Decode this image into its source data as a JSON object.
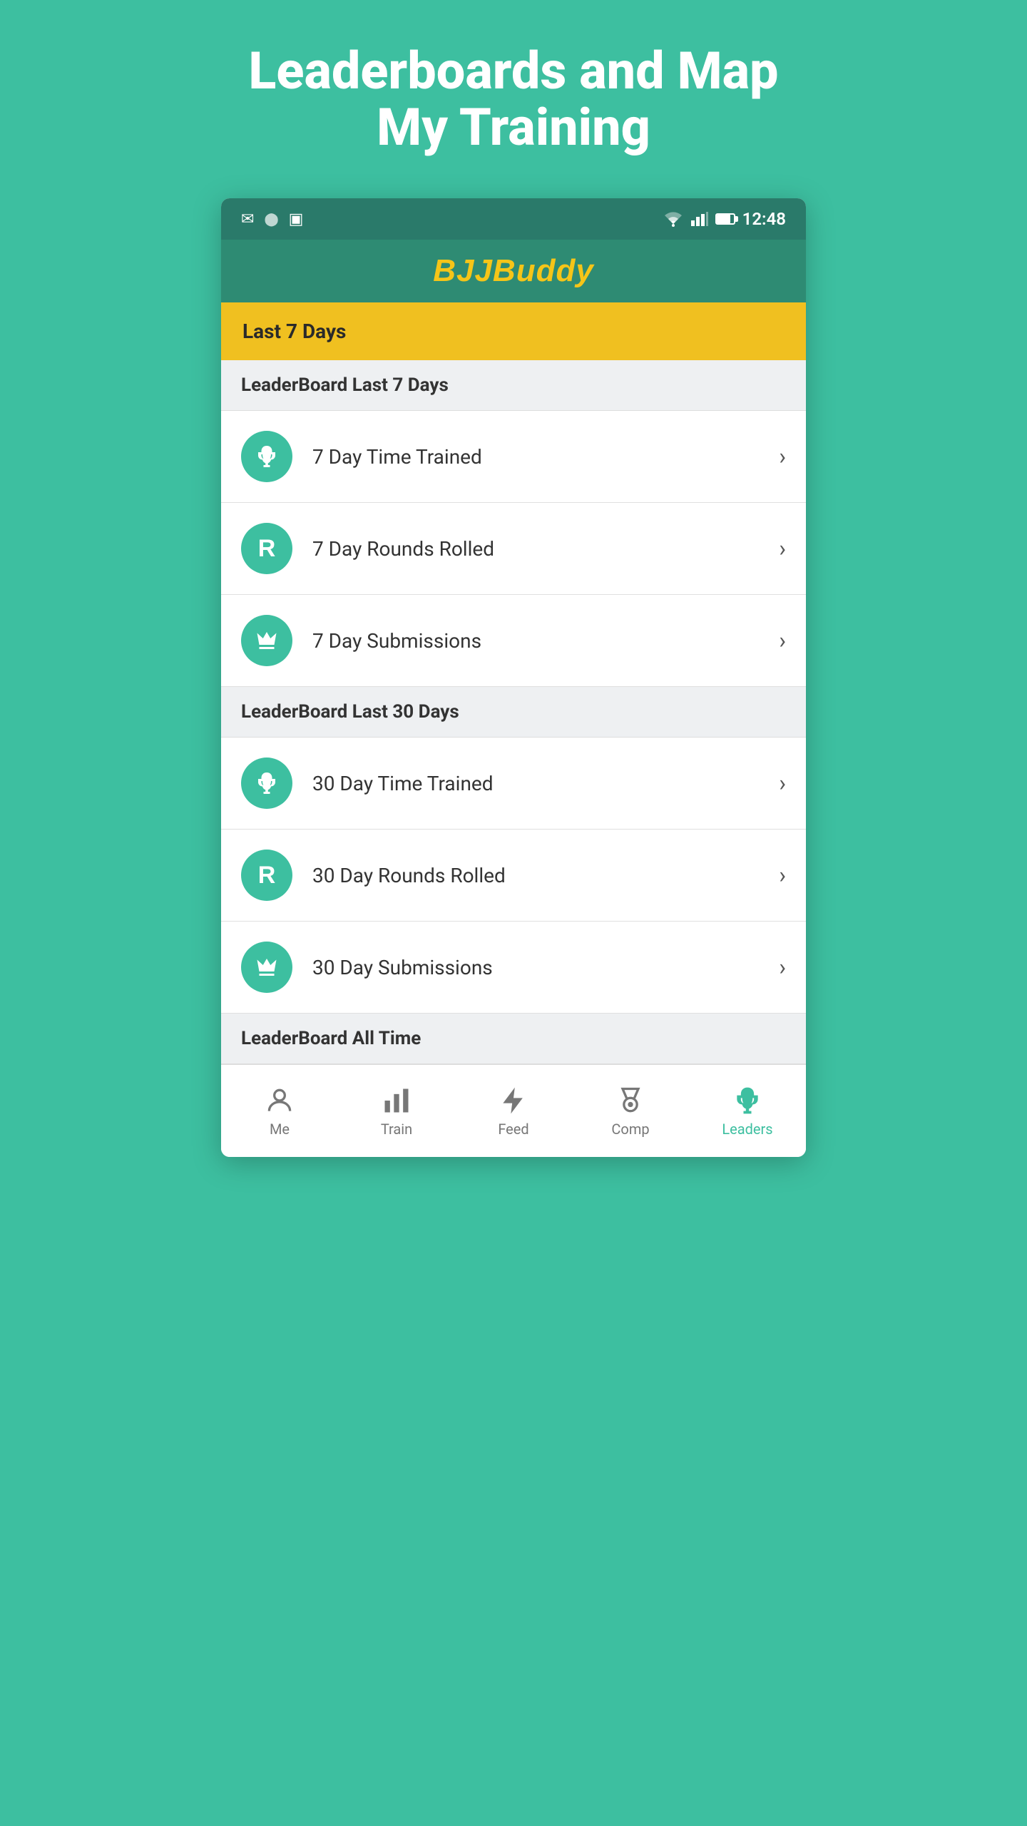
{
  "page": {
    "title_line1": "Leaderboards and Map",
    "title_line2": "My Training",
    "bg_color": "#3dbfa0"
  },
  "status_bar": {
    "time": "12:48",
    "icons": [
      "mail",
      "circle",
      "doc"
    ]
  },
  "header": {
    "logo": "BJJBuddy"
  },
  "filter_bar": {
    "label": "Last 7 Days"
  },
  "sections": [
    {
      "id": "leaderboard_7",
      "header": "LeaderBoard Last 7 Days",
      "items": [
        {
          "id": "7_time",
          "icon": "trophy",
          "label": "7 Day Time Trained"
        },
        {
          "id": "7_rounds",
          "icon": "rounds",
          "label": "7 Day Rounds Rolled"
        },
        {
          "id": "7_submissions",
          "icon": "crown",
          "label": "7 Day Submissions"
        }
      ]
    },
    {
      "id": "leaderboard_30",
      "header": "LeaderBoard Last 30 Days",
      "items": [
        {
          "id": "30_time",
          "icon": "trophy",
          "label": "30 Day Time Trained"
        },
        {
          "id": "30_rounds",
          "icon": "rounds",
          "label": "30 Day Rounds Rolled"
        },
        {
          "id": "30_submissions",
          "icon": "crown",
          "label": "30 Day Submissions"
        }
      ]
    },
    {
      "id": "leaderboard_all",
      "header": "LeaderBoard All Time",
      "items": []
    }
  ],
  "bottom_nav": [
    {
      "id": "me",
      "label": "Me",
      "icon": "person",
      "active": false
    },
    {
      "id": "train",
      "label": "Train",
      "icon": "bar-chart",
      "active": false
    },
    {
      "id": "feed",
      "label": "Feed",
      "icon": "lightning",
      "active": false
    },
    {
      "id": "comp",
      "label": "Comp",
      "icon": "medal",
      "active": false
    },
    {
      "id": "leaders",
      "label": "Leaders",
      "icon": "trophy",
      "active": true
    }
  ]
}
